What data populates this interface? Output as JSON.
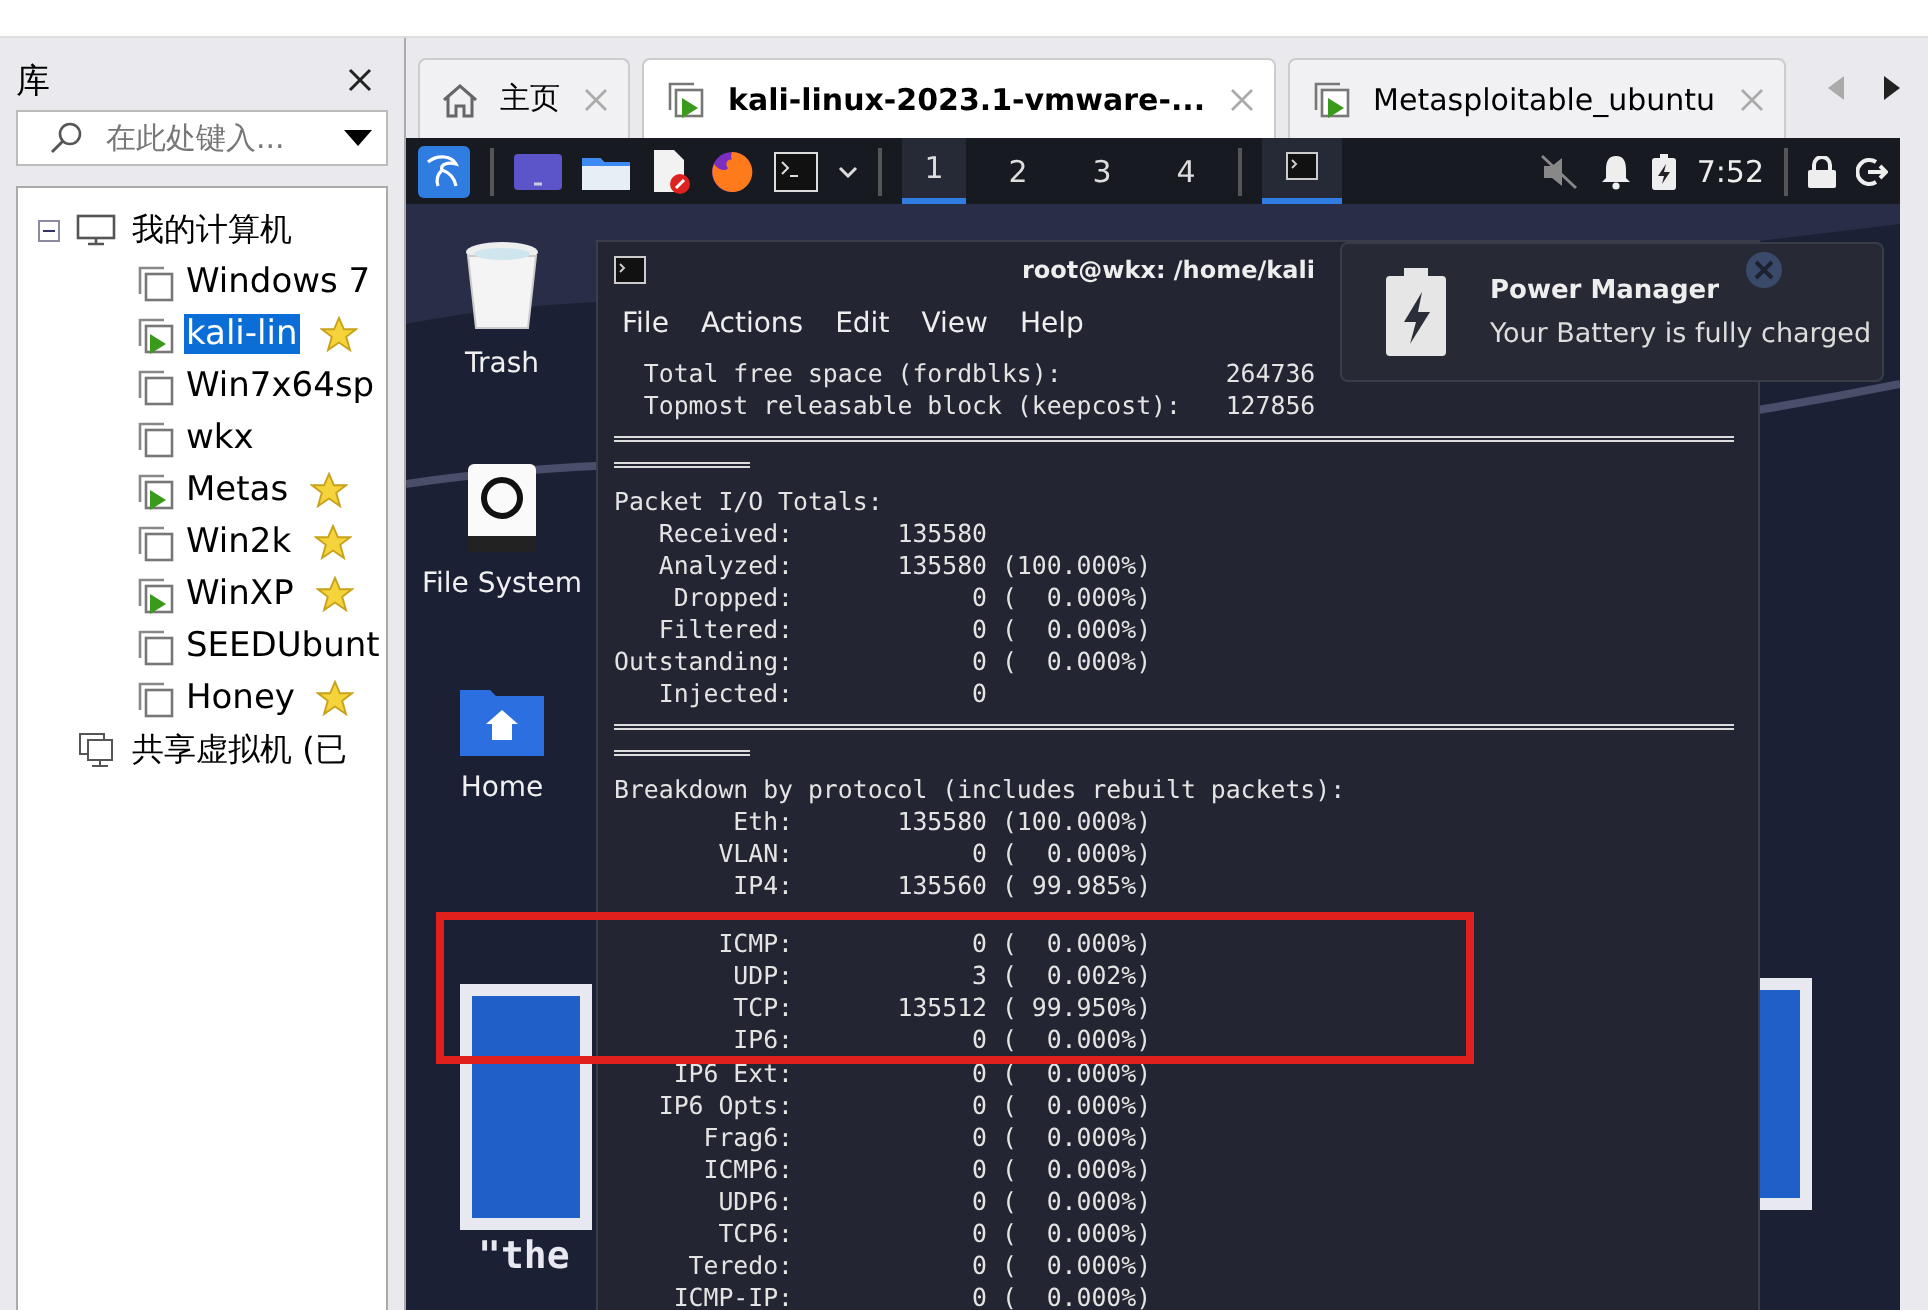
{
  "library": {
    "title": "库",
    "search": {
      "placeholder": "在此处键入..."
    },
    "tree": [
      {
        "label": "我的计算机",
        "kind": "computer",
        "expanded": true,
        "children": [
          {
            "label": "Windows 7",
            "running": false,
            "favorite": false,
            "selected": false
          },
          {
            "label": "kali-lin",
            "running": true,
            "favorite": true,
            "selected": true
          },
          {
            "label": "Win7x64sp",
            "running": false,
            "favorite": false,
            "selected": false
          },
          {
            "label": "wkx",
            "running": false,
            "favorite": false,
            "selected": false
          },
          {
            "label": "Metas",
            "running": true,
            "favorite": true,
            "selected": false
          },
          {
            "label": "Win2k",
            "running": false,
            "favorite": true,
            "selected": false
          },
          {
            "label": "WinXP",
            "running": true,
            "favorite": true,
            "selected": false
          },
          {
            "label": "SEEDUbunt",
            "running": false,
            "favorite": false,
            "selected": false
          },
          {
            "label": "Honey",
            "running": false,
            "favorite": true,
            "selected": false
          }
        ]
      },
      {
        "label": "共享虚拟机 (已",
        "kind": "shared"
      }
    ]
  },
  "tabs": [
    {
      "label": "主页",
      "kind": "home",
      "selected": false
    },
    {
      "label": "kali-linux-2023.1-vmware-...",
      "kind": "vm",
      "selected": true
    },
    {
      "label": "Metasploitable_ubuntu",
      "kind": "vm",
      "selected": false
    }
  ],
  "panel": {
    "workspaces": [
      {
        "label": "1",
        "selected": true
      },
      {
        "label": "2",
        "selected": false
      },
      {
        "label": "3",
        "selected": false
      },
      {
        "label": "4",
        "selected": false
      }
    ],
    "time": "7:52"
  },
  "desktop_icons": [
    {
      "label": "Trash",
      "kind": "trash"
    },
    {
      "label": "File System",
      "kind": "drive"
    },
    {
      "label": "Home",
      "kind": "home"
    }
  ],
  "wallpaper_quote": "\"the",
  "terminal": {
    "title": "root@wkx: /home/kali",
    "menu": [
      "File",
      "Actions",
      "Edit",
      "View",
      "Help"
    ],
    "lines": [
      {
        "kind": "text",
        "text": "  Total free space (fordblks):           264736"
      },
      {
        "kind": "text",
        "text": "  Topmost releasable block (keepcost):   127856"
      },
      {
        "kind": "rule"
      },
      {
        "kind": "short-rule"
      },
      {
        "kind": "text",
        "text": "Packet I/O Totals:"
      },
      {
        "kind": "text",
        "text": "   Received:       135580"
      },
      {
        "kind": "text",
        "text": "   Analyzed:       135580 (100.000%)"
      },
      {
        "kind": "text",
        "text": "    Dropped:            0 (  0.000%)"
      },
      {
        "kind": "text",
        "text": "   Filtered:            0 (  0.000%)"
      },
      {
        "kind": "text",
        "text": "Outstanding:            0 (  0.000%)"
      },
      {
        "kind": "text",
        "text": "   Injected:            0"
      },
      {
        "kind": "rule"
      },
      {
        "kind": "short-rule"
      },
      {
        "kind": "text",
        "text": "Breakdown by protocol (includes rebuilt packets):"
      },
      {
        "kind": "text",
        "text": "        Eth:       135580 (100.000%)"
      },
      {
        "kind": "text",
        "text": "       VLAN:            0 (  0.000%)"
      },
      {
        "kind": "text",
        "text": "        IP4:       135560 ( 99.985%)"
      },
      {
        "kind": "text",
        "text": "       ICMP:            0 (  0.000%)",
        "highlighted": true
      },
      {
        "kind": "text",
        "text": "        UDP:            3 (  0.002%)",
        "highlighted": true
      },
      {
        "kind": "text",
        "text": "        TCP:       135512 ( 99.950%)",
        "highlighted": true
      },
      {
        "kind": "text",
        "text": "        IP6:            0 (  0.000%)",
        "highlighted": true
      },
      {
        "kind": "text",
        "text": "    IP6 Ext:            0 (  0.000%)"
      },
      {
        "kind": "text",
        "text": "   IP6 Opts:            0 (  0.000%)"
      },
      {
        "kind": "text",
        "text": "      Frag6:            0 (  0.000%)"
      },
      {
        "kind": "text",
        "text": "      ICMP6:            0 (  0.000%)"
      },
      {
        "kind": "text",
        "text": "       UDP6:            0 (  0.000%)"
      },
      {
        "kind": "text",
        "text": "       TCP6:            0 (  0.000%)"
      },
      {
        "kind": "text",
        "text": "     Teredo:            0 (  0.000%)"
      },
      {
        "kind": "text",
        "text": "    ICMP-IP:            0 (  0.000%)"
      }
    ]
  },
  "notification": {
    "title": "Power Manager",
    "message": "Your Battery is fully charged"
  }
}
